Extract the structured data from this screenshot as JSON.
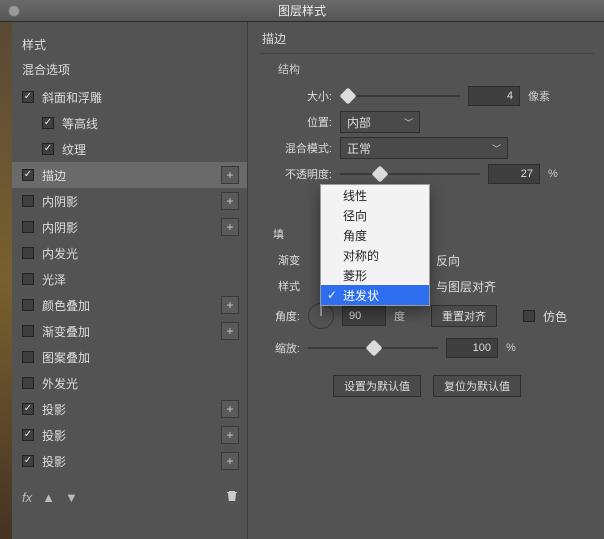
{
  "titlebar": {
    "title": "图层样式"
  },
  "left": {
    "styles_header": "样式",
    "blend_header": "混合选项",
    "items": [
      {
        "label": "斜面和浮雕",
        "checked": true,
        "add": false,
        "indent": 0
      },
      {
        "label": "等高线",
        "checked": true,
        "add": false,
        "indent": 1
      },
      {
        "label": "纹理",
        "checked": true,
        "add": false,
        "indent": 1
      },
      {
        "label": "描边",
        "checked": true,
        "add": true,
        "indent": 0,
        "selected": true
      },
      {
        "label": "内阴影",
        "checked": false,
        "add": true,
        "indent": 0
      },
      {
        "label": "内阴影",
        "checked": false,
        "add": true,
        "indent": 0
      },
      {
        "label": "内发光",
        "checked": false,
        "add": false,
        "indent": 0
      },
      {
        "label": "光泽",
        "checked": false,
        "add": false,
        "indent": 0
      },
      {
        "label": "颜色叠加",
        "checked": false,
        "add": true,
        "indent": 0
      },
      {
        "label": "渐变叠加",
        "checked": false,
        "add": true,
        "indent": 0
      },
      {
        "label": "图案叠加",
        "checked": false,
        "add": false,
        "indent": 0
      },
      {
        "label": "外发光",
        "checked": false,
        "add": false,
        "indent": 0
      },
      {
        "label": "投影",
        "checked": true,
        "add": true,
        "indent": 0
      },
      {
        "label": "投影",
        "checked": true,
        "add": true,
        "indent": 0
      },
      {
        "label": "投影",
        "checked": true,
        "add": true,
        "indent": 0
      }
    ],
    "fx_label": "fx"
  },
  "right": {
    "group_title": "描边",
    "structure_legend": "结构",
    "size_label": "大小:",
    "size_value": "4",
    "size_unit": "像素",
    "position_label": "位置:",
    "position_value": "内部",
    "blendmode_label": "混合模式:",
    "blendmode_value": "正常",
    "opacity_label": "不透明度:",
    "opacity_value": "27",
    "opacity_unit": "%",
    "fill_legend": "填",
    "grad_label": "渐变",
    "reverse_label": "反向",
    "style_label": "样式",
    "align_label": "与图层对齐",
    "angle_label": "角度:",
    "angle_value": "90",
    "angle_unit": "度",
    "reset_align": "重置对齐",
    "dither_label": "仿色",
    "scale_label": "缩放:",
    "scale_value": "100",
    "scale_unit": "%",
    "set_default": "设置为默认值",
    "reset_default": "复位为默认值",
    "menu": {
      "items": [
        "线性",
        "径向",
        "角度",
        "对称的",
        "菱形",
        "进发状"
      ],
      "selected": 5
    }
  }
}
